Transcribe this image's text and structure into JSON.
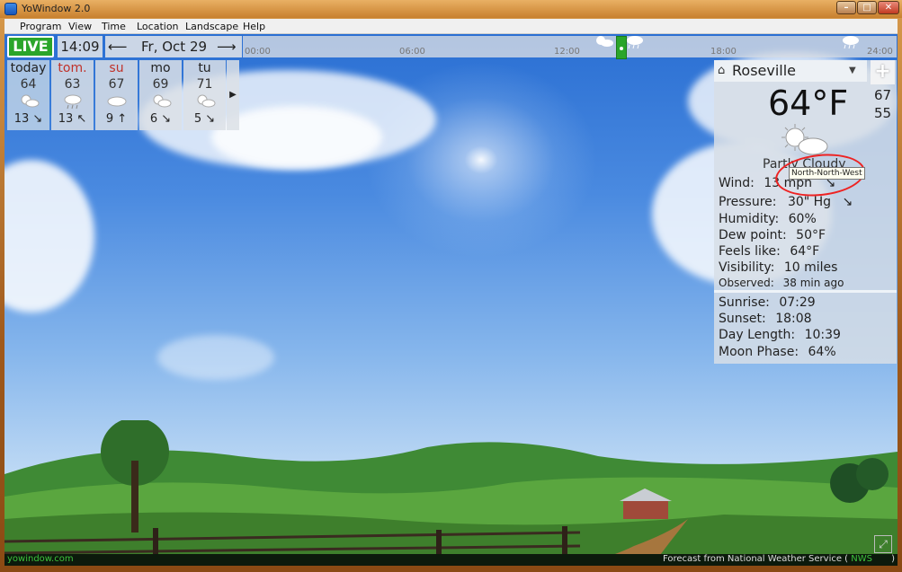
{
  "window": {
    "title": "YoWindow 2.0"
  },
  "menu": [
    "Program",
    "View",
    "Time",
    "Location",
    "Landscape",
    "Help"
  ],
  "topbar": {
    "live_label": "LIVE",
    "time": "14:09",
    "date": "Fr, Oct 29",
    "prev_arrow": "⟵",
    "next_arrow": "⟶"
  },
  "timeline": {
    "labels": [
      "00:00",
      "06:00",
      "12:00",
      "18:00",
      "24:00"
    ]
  },
  "forecast": [
    {
      "day": "today",
      "temp": "64",
      "wind": "13 ↘",
      "icon": "partly-cloudy-icon"
    },
    {
      "day": "tom.",
      "temp": "63",
      "wind": "13 ↖",
      "icon": "rain-icon"
    },
    {
      "day": "su",
      "temp": "67",
      "wind": "9 ↑",
      "icon": "cloudy-icon"
    },
    {
      "day": "mo",
      "temp": "69",
      "wind": "6 ↘",
      "icon": "partly-cloudy-icon"
    },
    {
      "day": "tu",
      "temp": "71",
      "wind": "5 ↘",
      "icon": "partly-cloudy-icon"
    }
  ],
  "more_label": "▶",
  "current": {
    "location": "Roseville",
    "temperature": "64°F",
    "high": "67",
    "low": "55",
    "condition": "Partly Cloudy",
    "wind_label": "Wind:",
    "wind_value": "13 mph",
    "wind_arrow": "↘",
    "pressure_label": "Pressure:",
    "pressure_value": "30\" Hg",
    "pressure_arrow": "↘",
    "humidity_label": "Humidity:",
    "humidity_value": "60%",
    "dew_label": "Dew point:",
    "dew_value": "50°F",
    "feels_label": "Feels like:",
    "feels_value": "64°F",
    "visibility_label": "Visibility:",
    "visibility_value": "10 miles",
    "observed_label": "Observed:",
    "observed_value": "38 min ago",
    "sunrise_label": "Sunrise:",
    "sunrise_value": "07:29",
    "sunset_label": "Sunset:",
    "sunset_value": "18:08",
    "daylength_label": "Day Length:",
    "daylength_value": "10:39",
    "moon_label": "Moon Phase:",
    "moon_value": "64%"
  },
  "tooltip": "North-North-West",
  "footer": {
    "site": "yowindow.com",
    "forecast_text": "Forecast from National Weather Service (",
    "nws": "NWS",
    "close_paren": ")"
  }
}
